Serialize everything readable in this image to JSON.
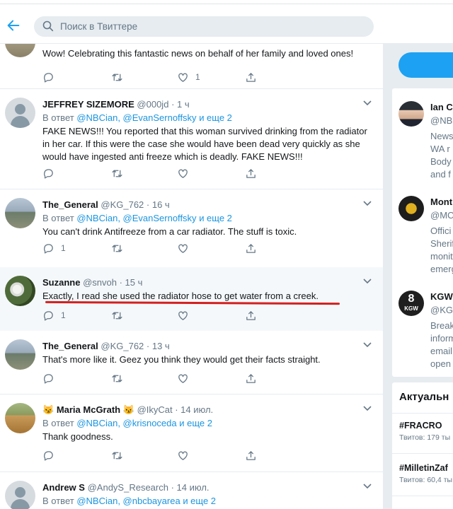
{
  "search": {
    "placeholder": "Поиск в Твиттере"
  },
  "tweets": [
    {
      "text": "Wow! Celebrating this fantastic news on behalf of her family and loved ones!",
      "likes": "1"
    },
    {
      "name": "JEFFREY SIZEMORE",
      "handle": "@000jd",
      "time": "· 1 ч",
      "reply_prefix": "В ответ",
      "reply_links": "@NBCian, @EvanSernoffsky",
      "reply_more": "и еще 2",
      "text": "FAKE NEWS!!! You reported that this woman survived drinking from the radiator in her car. If this were the case she would have been dead very quickly as she would have ingested anti freeze which is deadly. FAKE NEWS!!!"
    },
    {
      "name": "The_General",
      "handle": "@KG_762",
      "time": "· 16 ч",
      "reply_prefix": "В ответ",
      "reply_links": "@NBCian, @EvanSernoffsky",
      "reply_more": "и еще 2",
      "text": "You can't drink Antifreeze from a car radiator.  The stuff is toxic.",
      "replies": "1"
    },
    {
      "name": "Suzanne",
      "handle": "@snvoh",
      "time": "· 15 ч",
      "text": "Exactly, I read she used the radiator hose to get water from a creek.",
      "replies": "1"
    },
    {
      "name": "The_General",
      "handle": "@KG_762",
      "time": "· 13 ч",
      "text": "That's more like it. Geez you think they would get their facts straight."
    },
    {
      "name_emoji": "😼",
      "name": "Maria McGrath",
      "handle": "@IkyCat",
      "time": "· 14 июл.",
      "reply_prefix": "В ответ",
      "reply_links": "@NBCian, @krisnoceda",
      "reply_more": "и еще 2",
      "text": "Thank goodness."
    },
    {
      "name": "Andrew S",
      "handle": "@AndyS_Research",
      "time": "· 14 июл.",
      "reply_prefix": "В ответ",
      "reply_links": "@NBCian, @nbcbayarea",
      "reply_more": "и еще 2"
    }
  ],
  "suggestions": [
    {
      "name": "Ian C",
      "handle": "@NB",
      "bio": "News\nWA r\nBody\nand f"
    },
    {
      "name": "Mont",
      "handle": "@MC",
      "bio": "Offici\nSherif\nmonit\nemerg"
    },
    {
      "name": "KGW",
      "handle": "@KG",
      "bio": "Break\ninform\nemail\nopen",
      "avatar_text": "8",
      "avatar_sub": "KGW"
    }
  ],
  "trends": {
    "title": "Актуальн",
    "items": [
      {
        "name": "#FRACRO",
        "count": "Твитов: 179 ты"
      },
      {
        "name": "#MilletinZaf",
        "count": "Твитов: 60,4 ты"
      }
    ]
  },
  "colors": {
    "accent": "#1da1f2",
    "link": "#1b95e0",
    "highlight": "#f5f8fa",
    "annotation": "#d32020"
  }
}
